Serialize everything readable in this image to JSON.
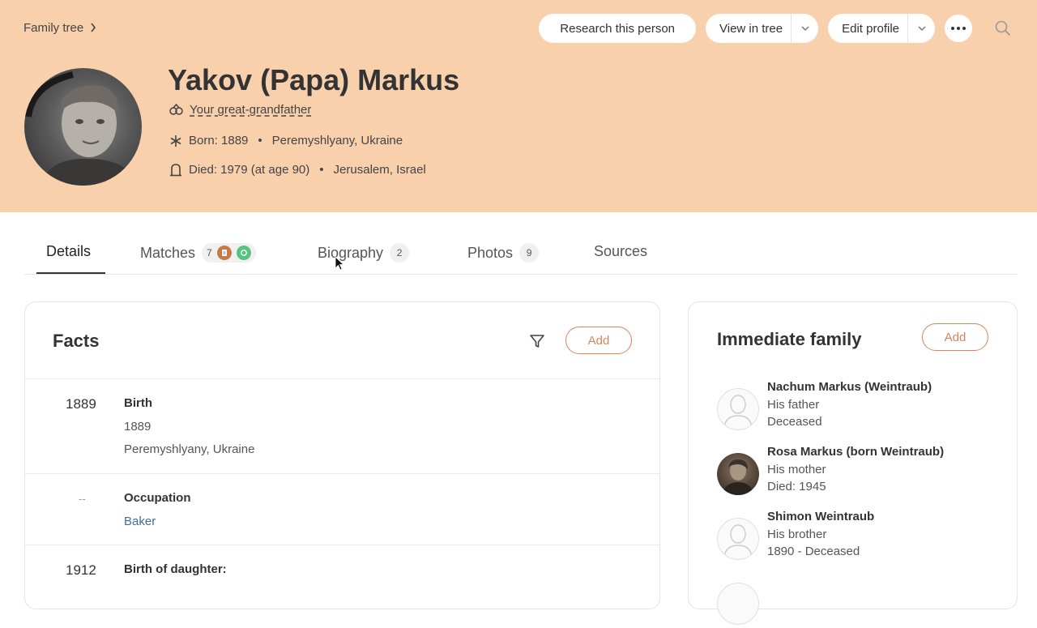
{
  "breadcrumb": {
    "label": "Family tree"
  },
  "header_actions": {
    "research": "Research this person",
    "view_tree": "View in tree",
    "edit_profile": "Edit profile"
  },
  "person": {
    "name": "Yakov (Papa) Markus",
    "relation": "Your great-grandfather",
    "born_label": "Born: 1889",
    "born_place": "Peremyshlyany, Ukraine",
    "died_label": "Died: 1979 (at age 90)",
    "died_place": "Jerusalem, Israel"
  },
  "tabs": [
    {
      "label": "Details"
    },
    {
      "label": "Matches",
      "count": "7"
    },
    {
      "label": "Biography",
      "count": "2"
    },
    {
      "label": "Photos",
      "count": "9"
    },
    {
      "label": "Sources"
    }
  ],
  "facts": {
    "title": "Facts",
    "add_label": "Add",
    "items": [
      {
        "year": "1889",
        "title": "Birth",
        "line1": "1889",
        "line2": "Peremyshlyany, Ukraine"
      },
      {
        "year": "--",
        "title": "Occupation",
        "line1": "Baker"
      },
      {
        "year": "1912",
        "title": "Birth of daughter:"
      }
    ]
  },
  "family": {
    "title": "Immediate family",
    "add_label": "Add",
    "members": [
      {
        "name": "Nachum Markus (Weintraub)",
        "relation": "His father",
        "status": "Deceased"
      },
      {
        "name": "Rosa Markus (born Weintraub)",
        "relation": "His mother",
        "status": "Died: 1945"
      },
      {
        "name": "Shimon Weintraub",
        "relation": "His brother",
        "status": "1890 - Deceased"
      }
    ]
  },
  "colors": {
    "header_bg": "#f9d0ac",
    "accent": "#d9845b",
    "link": "#3f6e99"
  }
}
